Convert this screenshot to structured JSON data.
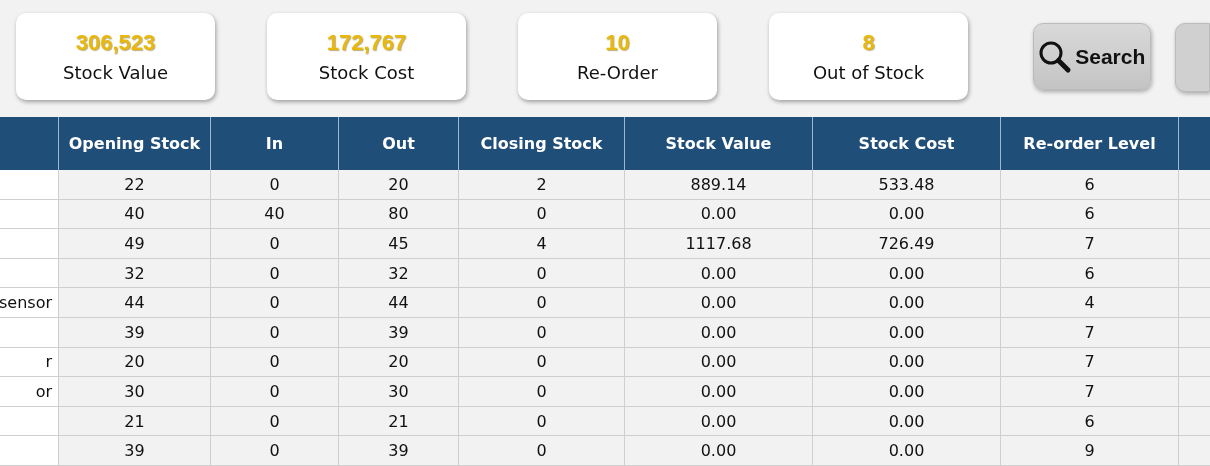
{
  "summary_cards": [
    {
      "value": "306,523",
      "label": "Stock Value"
    },
    {
      "value": "172,767",
      "label": "Stock Cost"
    },
    {
      "value": "10",
      "label": "Re-Order"
    },
    {
      "value": "8",
      "label": "Out of Stock"
    }
  ],
  "search_button": {
    "label": "Search"
  },
  "table": {
    "columns": [
      "Opening Stock",
      "In",
      "Out",
      "Closing Stock",
      "Stock Value",
      "Stock Cost",
      "Re-order Level"
    ],
    "rows": [
      {
        "cells": [
          "22",
          "0",
          "20",
          "2",
          "889.14",
          "533.48",
          "6"
        ]
      },
      {
        "cells": [
          "40",
          "40",
          "80",
          "0",
          "0.00",
          "0.00",
          "6"
        ]
      },
      {
        "cells": [
          "49",
          "0",
          "45",
          "4",
          "1117.68",
          "726.49",
          "7"
        ]
      },
      {
        "cells": [
          "32",
          "0",
          "32",
          "0",
          "0.00",
          "0.00",
          "6"
        ]
      },
      {
        "column_1": "sensor",
        "cells": [
          "44",
          "0",
          "44",
          "0",
          "0.00",
          "0.00",
          "4"
        ]
      },
      {
        "cells": [
          "39",
          "0",
          "39",
          "0",
          "0.00",
          "0.00",
          "7"
        ]
      },
      {
        "column_1": "r",
        "cells": [
          "20",
          "0",
          "20",
          "0",
          "0.00",
          "0.00",
          "7"
        ]
      },
      {
        "column_1": "or",
        "cells": [
          "30",
          "0",
          "30",
          "0",
          "0.00",
          "0.00",
          "7"
        ]
      },
      {
        "cells": [
          "21",
          "0",
          "21",
          "0",
          "0.00",
          "0.00",
          "6"
        ]
      },
      {
        "cells": [
          "39",
          "0",
          "39",
          "0",
          "0.00",
          "0.00",
          "9"
        ]
      }
    ]
  }
}
